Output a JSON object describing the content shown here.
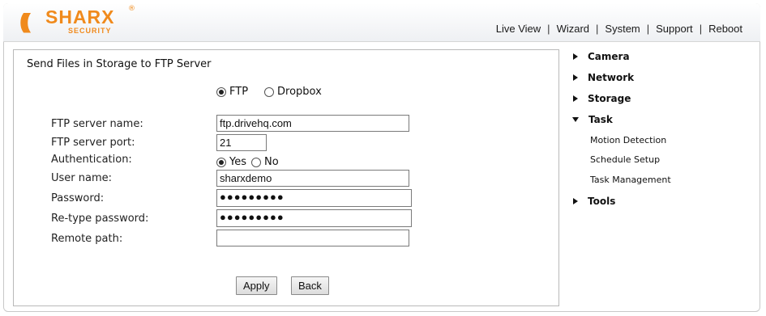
{
  "logo": {
    "word": "SHARX",
    "sub": "SECURITY",
    "reg": "®"
  },
  "topnav": {
    "items": [
      "Live View",
      "Wizard",
      "System",
      "Support",
      "Reboot"
    ],
    "sep": "|"
  },
  "panel": {
    "title": "Send Files in Storage to FTP Server",
    "protocol": {
      "options": [
        "FTP",
        "Dropbox"
      ],
      "selected": "FTP"
    },
    "labels": {
      "server_name": "FTP server name:",
      "server_port": "FTP server port:",
      "authentication": "Authentication:",
      "user_name": "User name:",
      "password": "Password:",
      "retype_password": "Re-type password:",
      "remote_path": "Remote path:"
    },
    "values": {
      "server_name": "ftp.drivehq.com",
      "server_port": "21",
      "user_name": "sharxdemo",
      "password": "●●●●●●●●●",
      "retype_password": "●●●●●●●●●",
      "remote_path": ""
    },
    "auth": {
      "options": [
        "Yes",
        "No"
      ],
      "selected": "Yes"
    },
    "buttons": {
      "apply": "Apply",
      "back": "Back"
    }
  },
  "sidebar": {
    "items": [
      {
        "label": "Camera",
        "expanded": false
      },
      {
        "label": "Network",
        "expanded": false
      },
      {
        "label": "Storage",
        "expanded": false
      },
      {
        "label": "Task",
        "expanded": true
      },
      {
        "label": "Tools",
        "expanded": false
      }
    ],
    "task_children": [
      "Motion Detection",
      "Schedule Setup",
      "Task Management"
    ]
  },
  "colors": {
    "brand": "#f08a1c"
  }
}
